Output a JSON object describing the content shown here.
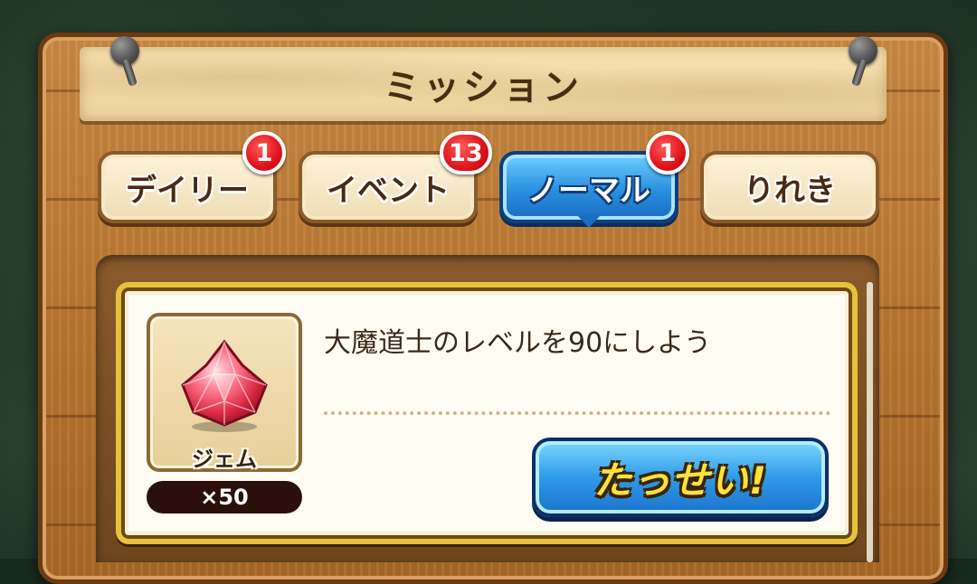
{
  "title": "ミッション",
  "tabs": [
    {
      "label": "デイリー",
      "badge": "1",
      "active": false
    },
    {
      "label": "イベント",
      "badge": "13",
      "active": false
    },
    {
      "label": "ノーマル",
      "badge": "1",
      "active": true
    },
    {
      "label": "りれき",
      "badge": null,
      "active": false
    }
  ],
  "mission": {
    "description": "大魔道士のレベルを90にしよう",
    "reward": {
      "name": "ジェム",
      "quantity": "×50",
      "icon": "gem-icon"
    },
    "claim_label": "たっせい!"
  },
  "colors": {
    "active_tab": "#2a8fe0",
    "badge": "#e0121a",
    "card_border": "#e6c23a",
    "claim_text": "#ffe23a"
  }
}
